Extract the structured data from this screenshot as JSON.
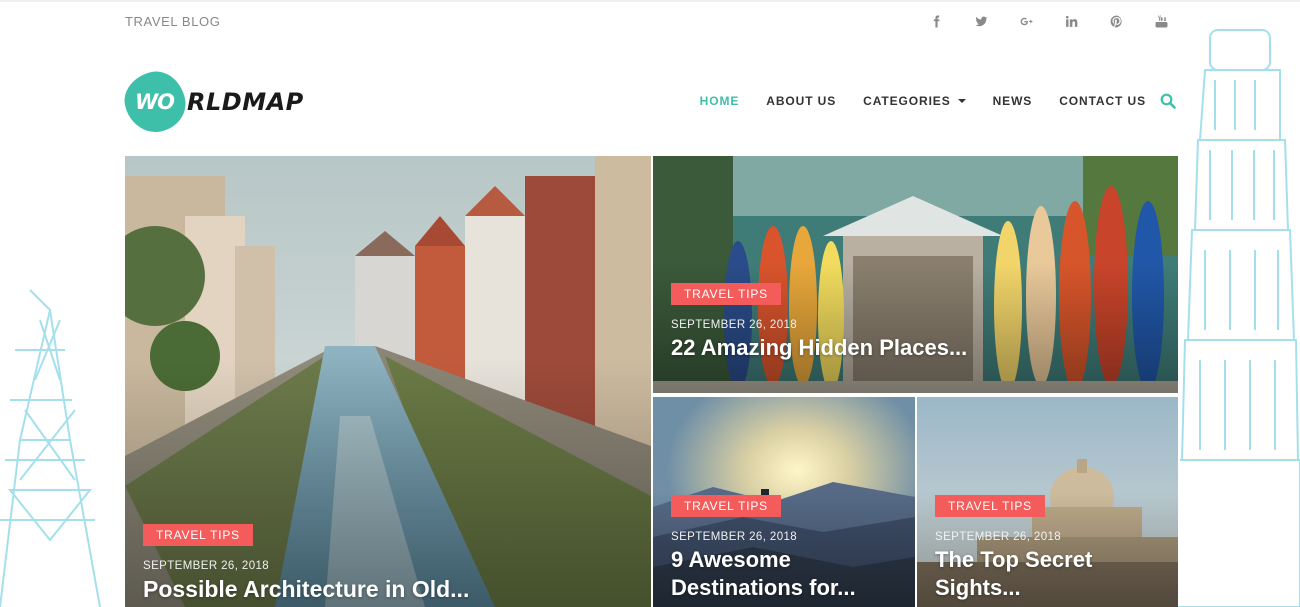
{
  "header": {
    "tagline": "TRAVEL BLOG",
    "socials": [
      {
        "name": "facebook-icon",
        "glyph": "f"
      },
      {
        "name": "twitter-icon",
        "glyph": "t"
      },
      {
        "name": "google-plus-icon",
        "glyph": "G+"
      },
      {
        "name": "linkedin-icon",
        "glyph": "in"
      },
      {
        "name": "pinterest-icon",
        "glyph": "p"
      },
      {
        "name": "youtube-icon",
        "glyph": "yt"
      }
    ]
  },
  "logo": {
    "mark": "WO",
    "text": "RLDMAP"
  },
  "nav": {
    "items": [
      {
        "label": "HOME",
        "active": true
      },
      {
        "label": "ABOUT US"
      },
      {
        "label": "CATEGORIES",
        "dropdown": true
      },
      {
        "label": "NEWS"
      },
      {
        "label": "CONTACT US"
      }
    ],
    "search_icon": "search-icon"
  },
  "colors": {
    "accent": "#3dbfa9",
    "badge": "#f45b5b"
  },
  "posts": [
    {
      "category": "TRAVEL TIPS",
      "date": "SEPTEMBER 26, 2018",
      "title": "Possible Architecture in Old..."
    },
    {
      "category": "TRAVEL TIPS",
      "date": "SEPTEMBER 26, 2018",
      "title": "22 Amazing Hidden Places..."
    },
    {
      "category": "TRAVEL TIPS",
      "date": "SEPTEMBER 26, 2018",
      "title": "9 Awesome Destinations for..."
    },
    {
      "category": "TRAVEL TIPS",
      "date": "SEPTEMBER 26, 2018",
      "title": "The Top Secret Sights..."
    }
  ]
}
